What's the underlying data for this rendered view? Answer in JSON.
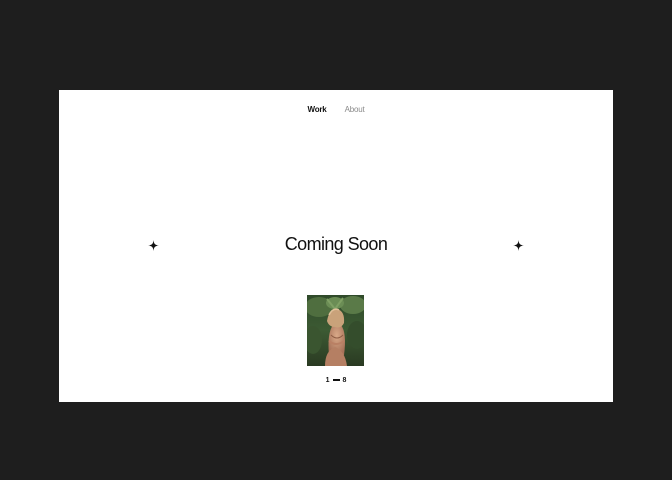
{
  "nav": {
    "items": [
      {
        "label": "Work",
        "active": true
      },
      {
        "label": "About",
        "active": false
      }
    ]
  },
  "hero": {
    "title": "Coming Soon",
    "decoration_icon": "sparkle-star-icon"
  },
  "gallery": {
    "current": "1",
    "total": "8"
  },
  "colors": {
    "backdrop": "#1e1e1e",
    "page": "#ffffff",
    "text": "#111111",
    "muted": "#8a8a8a"
  }
}
